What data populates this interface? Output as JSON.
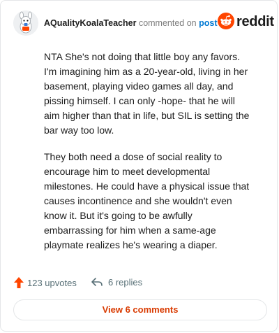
{
  "header": {
    "username": "AQualityKoalaTeacher",
    "action_text": "commented on",
    "post_link": "post",
    "logo_text": "reddit"
  },
  "comment": {
    "paragraphs": [
      "NTA She's not doing that little boy any favors. I'm imagining him as a 20-year-old, living in her basement, playing video games all day, and pissing himself. I can only -hope- that he will aim higher than that in life, but SIL is setting the bar way too low.",
      "They both need a dose of social reality to encourage him to meet developmental milestones. He could have a physical issue that causes incontinence and she wouldn't even know it. But it's going to be awfully embarrassing for him when a same-age playmate realizes he's wearing a diaper."
    ]
  },
  "actions": {
    "upvotes": "123 upvotes",
    "replies": "6 replies"
  },
  "footer": {
    "view_comments": "View 6 comments"
  },
  "colors": {
    "brand": "#ff4500",
    "link": "#0079d3",
    "view_button_text": "#d93a00",
    "muted": "#576f76"
  },
  "icons": {
    "avatar": "snoo-avatar",
    "logo": "reddit-snoo-icon",
    "upvote": "upvote-arrow-icon",
    "reply": "reply-arrow-icon"
  }
}
